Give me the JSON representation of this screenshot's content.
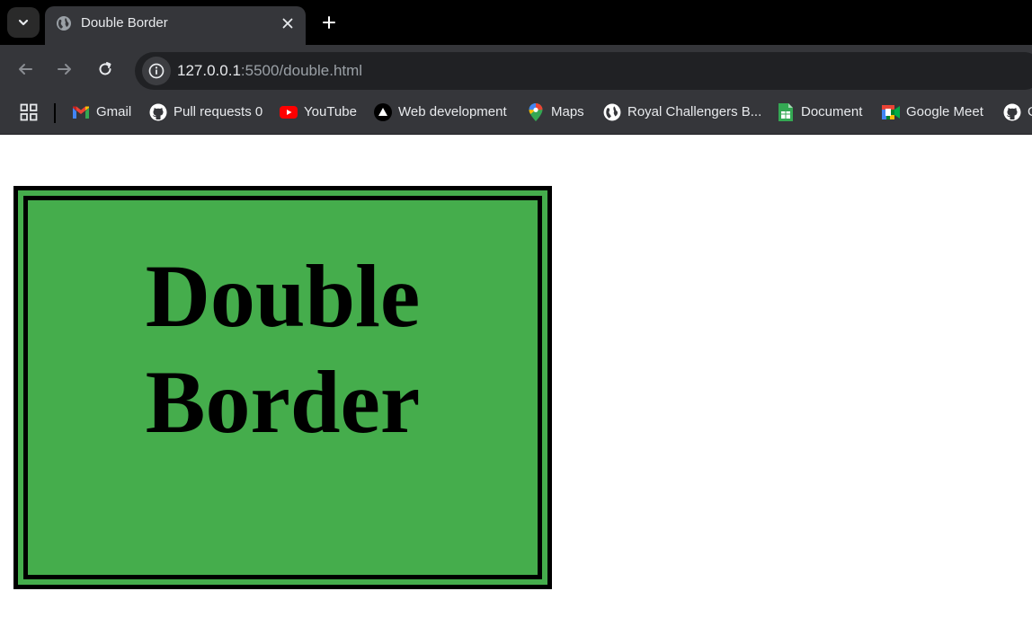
{
  "browser": {
    "tab": {
      "title": "Double Border"
    },
    "address": {
      "host": "127.0.0.1",
      "rest": ":5500/double.html"
    }
  },
  "bookmarks": [
    {
      "label": "Gmail",
      "icon": "gmail-icon"
    },
    {
      "label": "Pull requests 0",
      "icon": "github-icon"
    },
    {
      "label": "YouTube",
      "icon": "youtube-icon"
    },
    {
      "label": "Web development",
      "icon": "triangle-icon"
    },
    {
      "label": "Maps",
      "icon": "maps-icon"
    },
    {
      "label": "Royal Challengers B...",
      "icon": "globe-icon"
    },
    {
      "label": "Document",
      "icon": "docs-icon"
    },
    {
      "label": "Google Meet",
      "icon": "meet-icon"
    },
    {
      "label": "G",
      "icon": "github-icon"
    }
  ],
  "page": {
    "heading": "Double Border",
    "box_color": "#45ad4c",
    "border_color": "#000000"
  }
}
